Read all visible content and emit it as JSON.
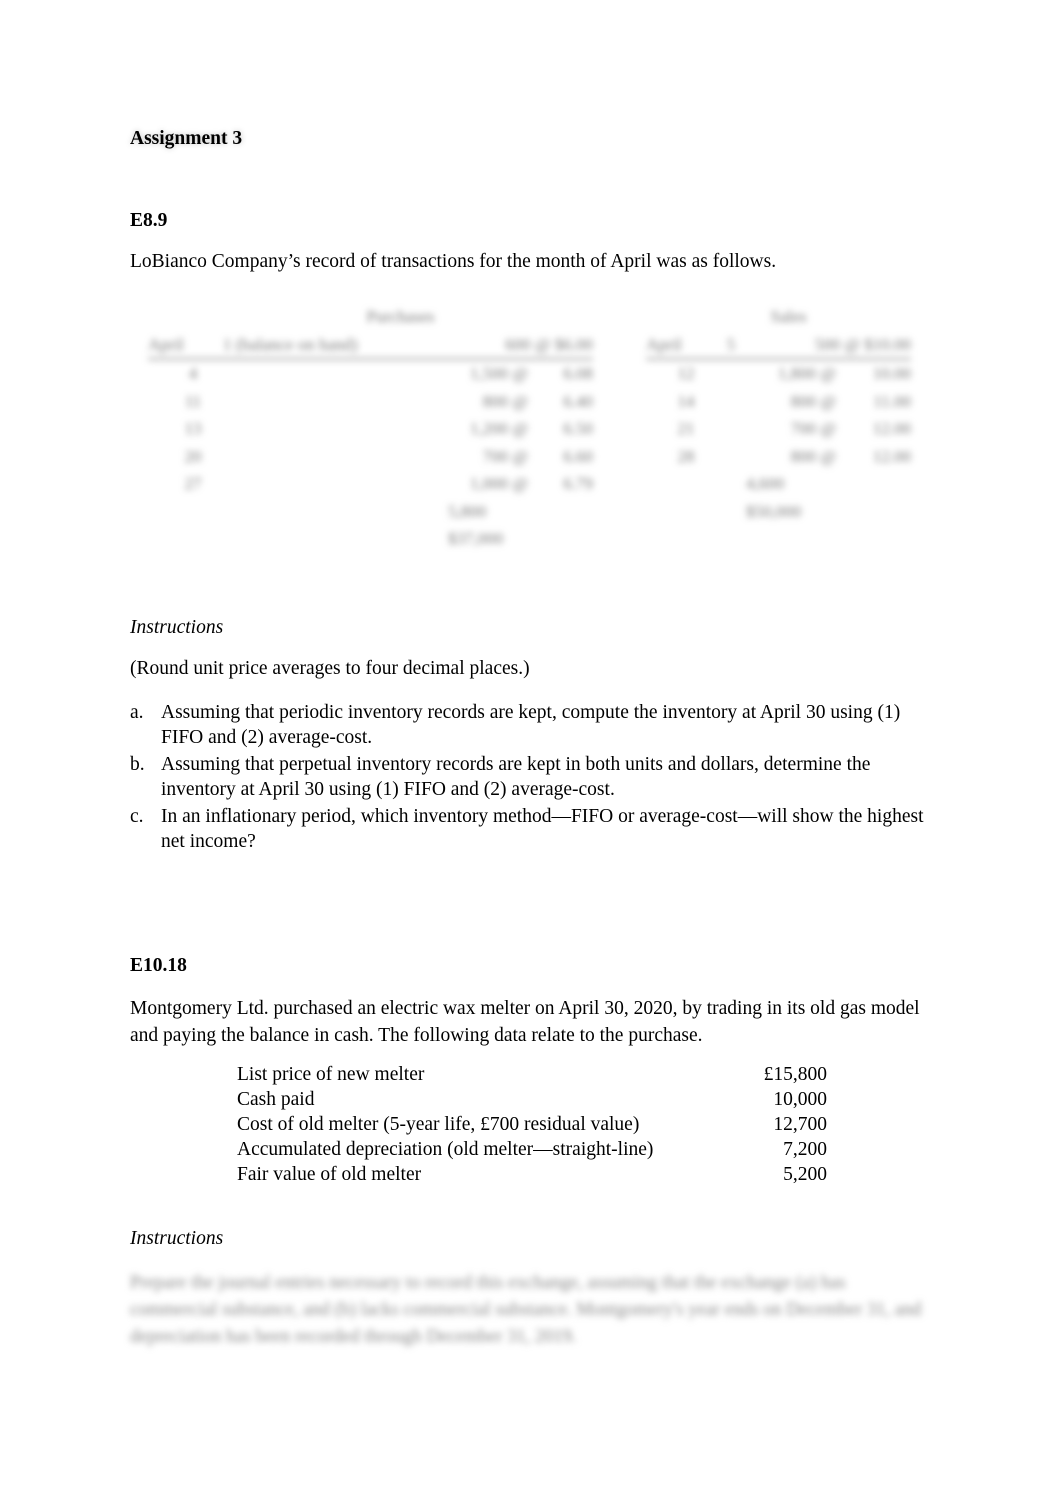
{
  "title": "Assignment 3",
  "e89": {
    "heading": "E8.9",
    "intro": "LoBianco Company’s record of transactions for the month of April was as follows.",
    "purchases": {
      "caption": "Purchases",
      "headers": [
        "April",
        "1 (balance on hand)",
        "600 @ $6.00"
      ],
      "rows": [
        [
          "4",
          "1,500 @",
          "6.08"
        ],
        [
          "11",
          "800 @",
          "6.40"
        ],
        [
          "13",
          "1,200 @",
          "6.50"
        ],
        [
          "20",
          "700 @",
          "6.60"
        ],
        [
          "27",
          "1,000 @",
          "6.79"
        ]
      ],
      "total_units": "5,800",
      "total_cost": "$37,000"
    },
    "sales": {
      "caption": "Sales",
      "headers": [
        "April",
        "5",
        "500 @ $10.00"
      ],
      "rows": [
        [
          "12",
          "1,800 @",
          "10.00"
        ],
        [
          "14",
          "800 @",
          "11.00"
        ],
        [
          "21",
          "700 @",
          "12.00"
        ],
        [
          "28",
          "800 @",
          "12.00"
        ]
      ],
      "total_units": "4,600",
      "total_sales": "$50,000"
    },
    "instructions_label": "Instructions",
    "note": "(Round unit price averages to four decimal places.)",
    "items": [
      {
        "marker": "a.",
        "text": "Assuming that periodic inventory records are kept, compute the inventory at April 30 using (1) FIFO and (2) average-cost."
      },
      {
        "marker": "b.",
        "text": "Assuming that perpetual inventory records are kept in both units and dollars, determine the inventory at April 30 using (1) FIFO and (2) average-cost."
      },
      {
        "marker": "c.",
        "text": "In an inflationary period, which inventory method—FIFO or average-cost—will show the highest net income?"
      }
    ]
  },
  "e1018": {
    "heading": "E10.18",
    "intro": "Montgomery Ltd. purchased an electric wax melter on April 30, 2020, by trading in its old gas model and paying the balance in cash. The following data relate to the purchase.",
    "data": [
      {
        "label": "List price of new melter",
        "value": "£15,800"
      },
      {
        "label": "Cash paid",
        "value": "10,000"
      },
      {
        "label": "Cost of old melter (5-year life, £700 residual value)",
        "value": "12,700"
      },
      {
        "label": "Accumulated depreciation (old melter—straight-line)",
        "value": "7,200"
      },
      {
        "label": "Fair value of old melter",
        "value": "5,200"
      }
    ],
    "instructions_label": "Instructions",
    "instructions_text": "Prepare the journal entries necessary to record this exchange, assuming that the exchange (a) has commercial substance, and (b) lacks commercial substance. Montgomery's year ends on December 31, and depreciation has been recorded through December 31, 2019."
  }
}
